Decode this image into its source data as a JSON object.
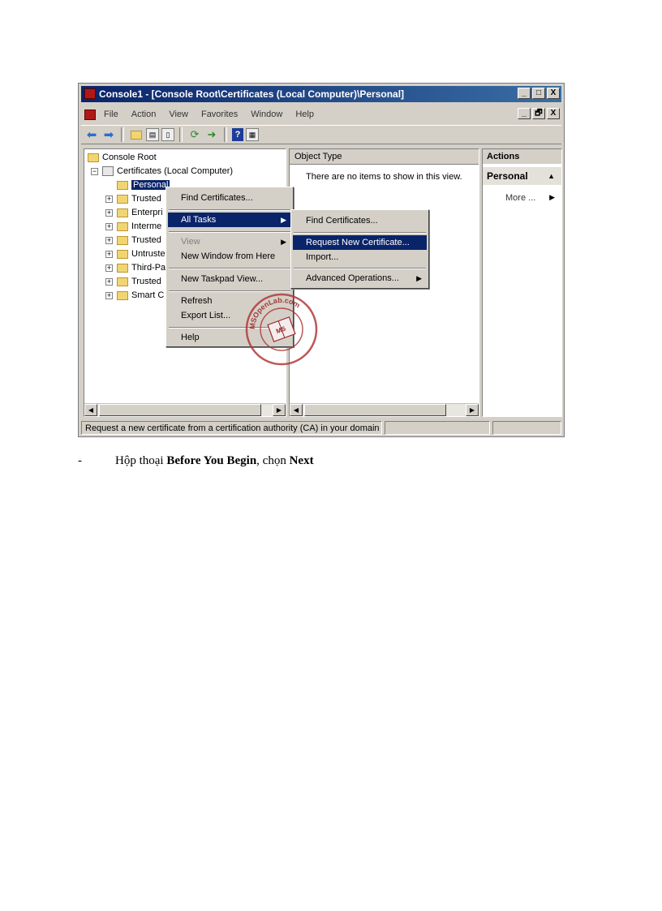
{
  "window": {
    "title": "Console1 - [Console Root\\Certificates (Local Computer)\\Personal]",
    "buttons": [
      "_",
      "□",
      "X"
    ],
    "mdi_buttons": [
      "_",
      "🗗",
      "X"
    ]
  },
  "menubar": [
    "File",
    "Action",
    "View",
    "Favorites",
    "Window",
    "Help"
  ],
  "toolbar": {
    "icons": [
      "back-arrow-icon",
      "forward-arrow-icon",
      "up-folder-icon",
      "show-hide-tree-icon",
      "copy-icon",
      "refresh-icon",
      "export-icon",
      "help-icon",
      "properties-icon"
    ]
  },
  "tree": {
    "root": "Console Root",
    "certificates": "Certificates (Local Computer)",
    "selected": "Personal",
    "items": [
      "Trusted",
      "Enterpri",
      "Interme",
      "Trusted",
      "Untruste",
      "Third-Pa",
      "Trusted",
      "Smart C"
    ]
  },
  "middle": {
    "column_header": "Object Type",
    "empty_message": "There are no items to show in this view."
  },
  "actions": {
    "header": "Actions",
    "section": "Personal",
    "item": "More ..."
  },
  "context_menu": {
    "find_certificates": "Find Certificates...",
    "all_tasks": "All Tasks",
    "view": "View",
    "new_window": "New Window from Here",
    "new_taskpad": "New Taskpad View...",
    "refresh": "Refresh",
    "export_list": "Export List...",
    "help": "Help"
  },
  "submenu": {
    "find_certificates": "Find Certificates...",
    "request_new": "Request New Certificate...",
    "import": "Import...",
    "advanced": "Advanced Operations..."
  },
  "status": {
    "text": "Request a new certificate from a certification authority (CA) in your domain"
  },
  "watermark": {
    "text": "MSOpenLab.com",
    "badge": "MS"
  },
  "caption": {
    "bullet": "-",
    "prefix": "Hộp thoại ",
    "dialog": "Before You Begin",
    "middle": ", chọn ",
    "action": "Next"
  }
}
